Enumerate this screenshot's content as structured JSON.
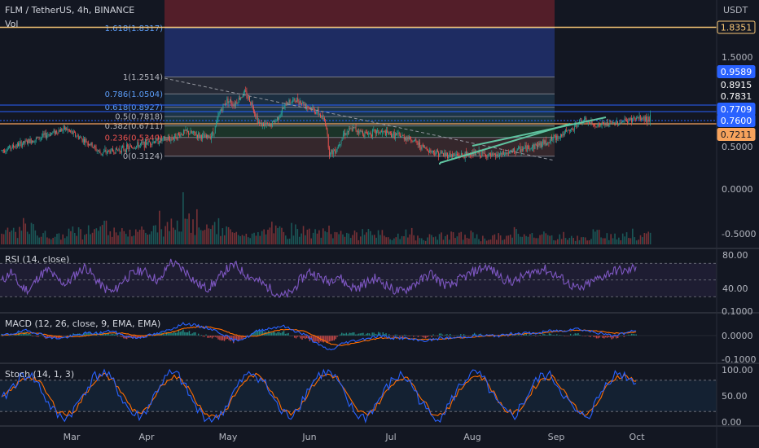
{
  "header": {
    "symbol": "FLM / TetherUS, 4h, BINANCE",
    "vol_label": "Vol",
    "currency": "USDT"
  },
  "indicators": {
    "rsi": "RSI (14, close)",
    "macd": "MACD (12, 26, close, 9, EMA, EMA)",
    "stoch": "Stoch (14, 1, 3)"
  },
  "colors": {
    "background": "#131722",
    "up": "#26a69a",
    "down": "#ef5350",
    "rsi_line": "#7e57c2",
    "macd_line": "#2962ff",
    "signal_line": "#ff6d00",
    "stoch_k": "#2962ff",
    "stoch_d": "#ff6d00",
    "channel": "#5fc3a0"
  },
  "chart_data": {
    "type": "candlestick",
    "x_axis_labels": [
      "Mar",
      "Apr",
      "May",
      "Jun",
      "Jul",
      "Aug",
      "Sep",
      "Oct"
    ],
    "price_axis_ticks": [
      "1.5000",
      "0.5000",
      "0.0000",
      "-0.5000"
    ],
    "price_tags": [
      {
        "label": "1.8351",
        "style": "orange-outline"
      },
      {
        "label": "0.9589",
        "style": "blue"
      },
      {
        "label": "0.8915",
        "style": "dark"
      },
      {
        "label": "0.7831",
        "style": "dark"
      },
      {
        "label": "0.7709",
        "style": "blue"
      },
      {
        "label": "0.7600",
        "style": "blue-current"
      },
      {
        "label": "0.7211",
        "style": "orange"
      }
    ],
    "fib_levels": [
      {
        "label": "1.618(1.8317)",
        "value": 1.8317
      },
      {
        "label": "1(1.2514)",
        "value": 1.2514
      },
      {
        "label": "0.786(1.0504)",
        "value": 1.0504
      },
      {
        "label": "0.618(0.8927)",
        "value": 0.8927
      },
      {
        "label": "0.5(0.7818)",
        "value": 0.7818
      },
      {
        "label": "0.382(0.6711)",
        "value": 0.6711
      },
      {
        "label": "0.236(0.5340)",
        "value": 0.534
      },
      {
        "label": "0(0.3124)",
        "value": 0.3124
      }
    ],
    "price_path": [
      [
        0,
        0.38
      ],
      [
        5,
        0.45
      ],
      [
        10,
        0.52
      ],
      [
        15,
        0.6
      ],
      [
        18,
        0.64
      ],
      [
        21,
        0.56
      ],
      [
        25,
        0.46
      ],
      [
        28,
        0.35
      ],
      [
        32,
        0.38
      ],
      [
        37,
        0.42
      ],
      [
        42,
        0.48
      ],
      [
        48,
        0.52
      ],
      [
        52,
        0.6
      ],
      [
        55,
        0.57
      ],
      [
        58,
        0.53
      ],
      [
        60,
        0.58
      ],
      [
        62,
        0.85
      ],
      [
        64,
        0.98
      ],
      [
        66,
        0.93
      ],
      [
        69,
        1.07
      ],
      [
        71,
        0.93
      ],
      [
        73,
        0.7
      ],
      [
        76,
        0.67
      ],
      [
        78,
        0.75
      ],
      [
        81,
        0.95
      ],
      [
        84,
        0.98
      ],
      [
        87,
        0.9
      ],
      [
        90,
        0.82
      ],
      [
        92,
        0.7
      ],
      [
        93,
        0.34
      ],
      [
        95,
        0.4
      ],
      [
        97,
        0.58
      ],
      [
        100,
        0.64
      ],
      [
        103,
        0.58
      ],
      [
        107,
        0.6
      ],
      [
        112,
        0.56
      ],
      [
        116,
        0.52
      ],
      [
        119,
        0.43
      ],
      [
        122,
        0.37
      ],
      [
        126,
        0.33
      ],
      [
        131,
        0.32
      ],
      [
        135,
        0.35
      ],
      [
        139,
        0.31
      ],
      [
        142,
        0.33
      ],
      [
        146,
        0.38
      ],
      [
        150,
        0.42
      ],
      [
        154,
        0.47
      ],
      [
        158,
        0.55
      ],
      [
        162,
        0.63
      ],
      [
        164,
        0.73
      ],
      [
        166,
        0.72
      ],
      [
        168,
        0.68
      ],
      [
        172,
        0.69
      ],
      [
        176,
        0.72
      ],
      [
        180,
        0.76
      ]
    ],
    "volume_profile": [
      0.22,
      0.26,
      0.23,
      0.28,
      0.3,
      0.18,
      0.19,
      0.15,
      0.16,
      0.24,
      0.27,
      0.15,
      0.27,
      0.33,
      0.31,
      0.22,
      0.22,
      0.28,
      0.27,
      0.3,
      0.2,
      0.3,
      0.3,
      0.36,
      0.43,
      0.68,
      0.36,
      0.46,
      0.27,
      0.3,
      0.22,
      0.28,
      0.19,
      0.25,
      0.21,
      0.17,
      0.23,
      0.37,
      0.25,
      0.18,
      0.28,
      0.24,
      0.21,
      0.21,
      0.22,
      0.19,
      0.2,
      0.25,
      0.19,
      0.16,
      0.24,
      0.25,
      0.19,
      0.12,
      0.14,
      0.14,
      0.26,
      0.13,
      0.13,
      0.14,
      0.16,
      0.16,
      0.17,
      0.17,
      0.15,
      0.19,
      0.12,
      0.12,
      0.15,
      0.13,
      0.15,
      0.24,
      0.15,
      0.22,
      0.18,
      0.19,
      0.14,
      0.17,
      0.13,
      0.13,
      0.11,
      0.15,
      0.2,
      0.2,
      0.16,
      0.15,
      0.21,
      0.21,
      0.12,
      0.17
    ],
    "rsi": {
      "ticks": [
        "80.00",
        "40.00"
      ],
      "levels": [
        70,
        50,
        30
      ],
      "values": [
        48,
        60,
        42,
        38,
        55,
        62,
        50,
        45,
        58,
        66,
        52,
        40,
        35,
        50,
        57,
        62,
        55,
        48,
        72,
        66,
        58,
        45,
        40,
        48,
        62,
        68,
        58,
        52,
        45,
        38,
        30,
        34,
        50,
        60,
        54,
        48,
        56,
        44,
        40,
        46,
        52,
        46,
        38,
        36,
        44,
        50,
        58,
        48,
        42,
        50,
        56,
        62,
        66,
        58,
        50,
        48,
        55,
        60,
        64,
        58,
        52,
        44,
        38,
        46,
        52,
        58,
        62,
        60,
        66
      ]
    },
    "macd": {
      "ticks": [
        "0.1000",
        "0.0000",
        "-0.1000"
      ],
      "macd": [
        0.0,
        0.01,
        0.02,
        0.01,
        -0.01,
        -0.01,
        0.0,
        0.01,
        0.01,
        0.02,
        0.0,
        -0.01,
        0.0,
        0.01,
        0.03,
        0.05,
        0.04,
        0.03,
        0.01,
        -0.02,
        -0.01,
        0.02,
        0.03,
        0.04,
        0.02,
        0.0,
        -0.04,
        -0.06,
        -0.03,
        -0.02,
        -0.01,
        0.0,
        -0.01,
        -0.01,
        -0.02,
        -0.02,
        -0.01,
        -0.01,
        -0.005,
        0.0,
        0.0,
        0.0,
        0.01,
        0.01,
        0.01,
        0.02,
        0.02,
        0.03,
        0.02,
        0.01,
        0.0,
        0.01,
        0.02
      ],
      "signal": [
        0.0,
        0.005,
        0.01,
        0.01,
        0.0,
        -0.005,
        -0.005,
        0.0,
        0.005,
        0.01,
        0.01,
        0.0,
        0.0,
        0.005,
        0.015,
        0.03,
        0.035,
        0.035,
        0.025,
        0.005,
        -0.005,
        0.0,
        0.015,
        0.025,
        0.025,
        0.015,
        -0.01,
        -0.035,
        -0.04,
        -0.03,
        -0.02,
        -0.01,
        -0.01,
        -0.01,
        -0.015,
        -0.015,
        -0.015,
        -0.01,
        -0.008,
        -0.004,
        0.0,
        0.0,
        0.005,
        0.008,
        0.01,
        0.015,
        0.018,
        0.022,
        0.022,
        0.018,
        0.01,
        0.01,
        0.015
      ]
    },
    "stoch": {
      "ticks": [
        "100.00",
        "50.00",
        "0.00"
      ],
      "levels": [
        80,
        20
      ],
      "k": [
        40,
        65,
        85,
        92,
        70,
        35,
        12,
        8,
        30,
        62,
        88,
        95,
        75,
        42,
        15,
        10,
        38,
        72,
        92,
        88,
        55,
        22,
        8,
        5,
        28,
        60,
        85,
        94,
        80,
        48,
        18,
        12,
        35,
        68,
        90,
        96,
        78,
        40,
        14,
        8,
        30,
        58,
        82,
        90,
        70,
        36,
        12,
        10,
        34,
        66,
        88,
        93,
        72,
        38,
        16,
        12,
        40,
        72,
        90,
        86,
        60,
        30,
        10,
        14,
        48,
        80,
        94,
        88,
        74
      ],
      "d": [
        45,
        60,
        78,
        88,
        78,
        50,
        22,
        14,
        25,
        55,
        80,
        90,
        80,
        52,
        25,
        16,
        32,
        64,
        85,
        88,
        65,
        35,
        15,
        10,
        22,
        52,
        78,
        90,
        84,
        58,
        28,
        18,
        30,
        60,
        84,
        92,
        84,
        52,
        24,
        14,
        26,
        52,
        76,
        86,
        76,
        46,
        20,
        14,
        30,
        58,
        82,
        90,
        78,
        48,
        22,
        16,
        34,
        64,
        84,
        86,
        68,
        40,
        18,
        16,
        40,
        72,
        88,
        88,
        78
      ]
    }
  }
}
